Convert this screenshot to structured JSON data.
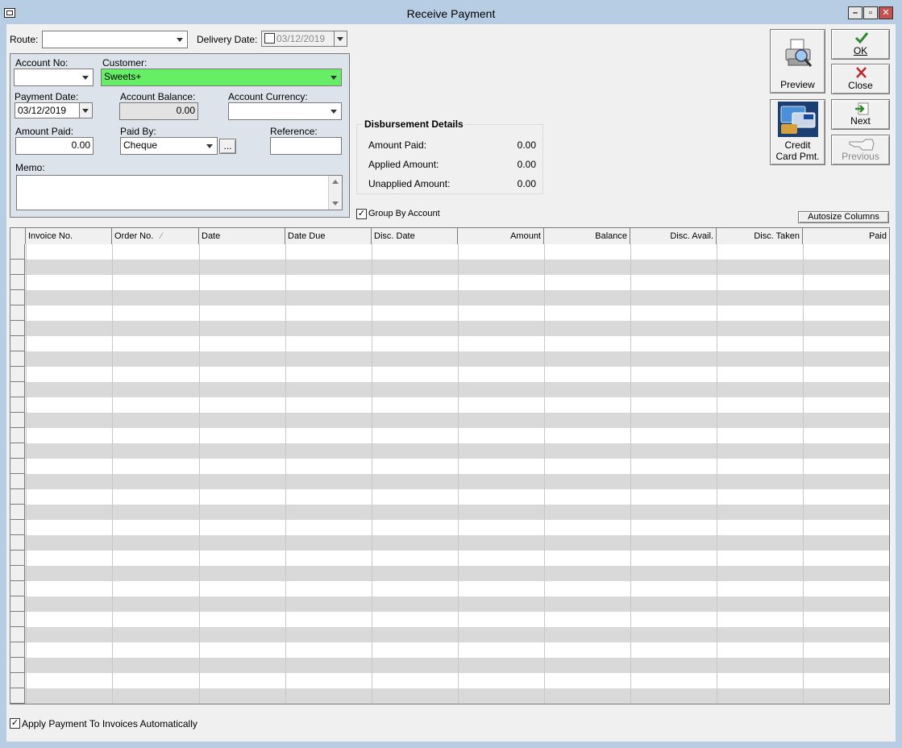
{
  "window": {
    "title": "Receive Payment"
  },
  "route": {
    "label": "Route:",
    "value": ""
  },
  "delivery_date": {
    "label": "Delivery Date:",
    "value": "03/12/2019"
  },
  "account_no": {
    "label": "Account No:",
    "value": ""
  },
  "customer": {
    "label": "Customer:",
    "value": "Sweets+",
    "highlight_color": "#66ee66"
  },
  "payment_date": {
    "label": "Payment Date:",
    "value": "03/12/2019"
  },
  "account_balance": {
    "label": "Account Balance:",
    "value": "0.00"
  },
  "account_currency": {
    "label": "Account Currency:",
    "value": ""
  },
  "amount_paid": {
    "label": "Amount Paid:",
    "value": "0.00"
  },
  "paid_by": {
    "label": "Paid By:",
    "value": "Cheque",
    "ellipsis": "..."
  },
  "reference": {
    "label": "Reference:",
    "value": ""
  },
  "memo": {
    "label": "Memo:",
    "value": ""
  },
  "disbursement": {
    "title": "Disbursement Details",
    "amount_paid_label": "Amount Paid:",
    "amount_paid": "0.00",
    "applied_label": "Applied Amount:",
    "applied": "0.00",
    "unapplied_label": "Unapplied Amount:",
    "unapplied": "0.00"
  },
  "group_by_account": {
    "label": "Group By Account",
    "checked": true
  },
  "buttons": {
    "preview": "Preview",
    "ok": "OK",
    "close": "Close",
    "credit_card": "Credit",
    "credit_card_line2": "Card Pmt.",
    "next": "Next",
    "previous": "Previous",
    "autosize": "Autosize Columns"
  },
  "grid": {
    "columns": [
      "Invoice No.",
      "Order No.",
      "Date",
      "Date Due",
      "Disc. Date",
      "Amount",
      "Balance",
      "Disc. Avail.",
      "Disc. Taken",
      "Paid"
    ],
    "sort_indicator": "⁄"
  },
  "apply_auto": {
    "label": "Apply Payment To Invoices Automatically",
    "checked": true
  }
}
